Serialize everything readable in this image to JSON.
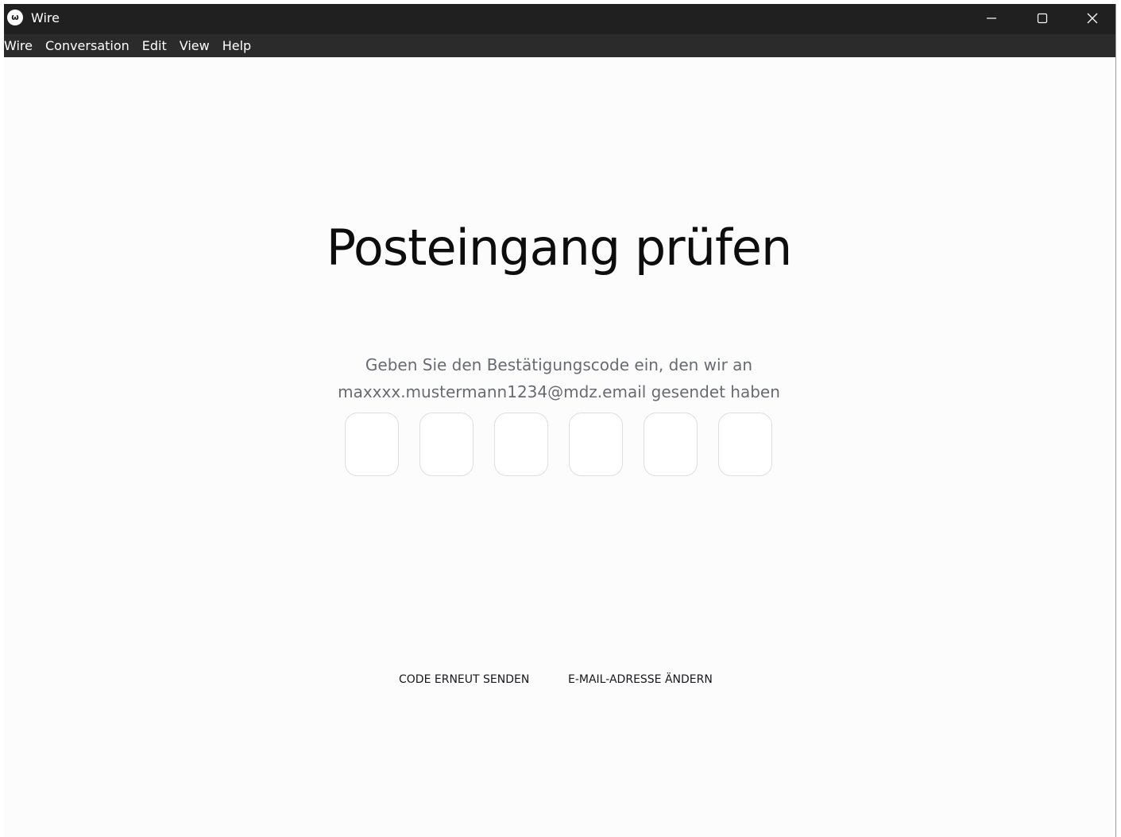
{
  "window": {
    "logo_glyph": "ω",
    "title": "Wire"
  },
  "menu": {
    "items": [
      {
        "label": "Wire"
      },
      {
        "label": "Conversation"
      },
      {
        "label": "Edit"
      },
      {
        "label": "View"
      },
      {
        "label": "Help"
      }
    ]
  },
  "main": {
    "heading": "Posteingang prüfen",
    "instruction_line1": "Geben Sie den Bestätigungscode ein, den wir an",
    "instruction_line2": "maxxxx.mustermann1234@mdz.email gesendet haben",
    "code_inputs": [
      "",
      "",
      "",
      "",
      "",
      ""
    ],
    "resend_label": "CODE ERNEUT SENDEN",
    "change_email_label": "E-MAIL-ADRESSE ÄNDERN"
  },
  "colors": {
    "titlebar": "#202020",
    "menubar": "#2b2b2b",
    "background": "#fdfcfd",
    "subtext": "#676b71",
    "input_border": "#dcdee1"
  },
  "icons": {
    "app": "wire-logo-icon",
    "minimize": "minimize-icon",
    "maximize": "maximize-icon",
    "close": "close-icon"
  }
}
